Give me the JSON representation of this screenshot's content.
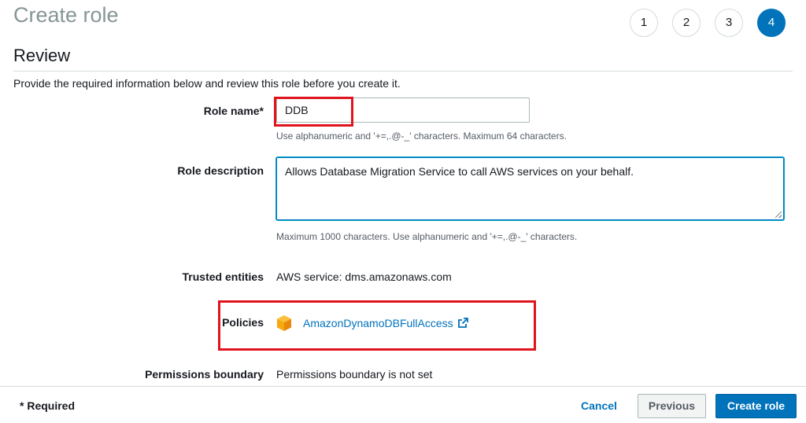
{
  "header": {
    "title": "Create role",
    "steps": [
      "1",
      "2",
      "3",
      "4"
    ],
    "active_step": "4"
  },
  "review": {
    "title": "Review",
    "intro": "Provide the required information below and review this role before you create it."
  },
  "role_name": {
    "label": "Role name*",
    "value": "DDB",
    "hint": "Use alphanumeric and '+=,.@-_' characters. Maximum 64 characters."
  },
  "role_description": {
    "label": "Role description",
    "value": "Allows Database Migration Service to call AWS services on your behalf.",
    "hint": "Maximum 1000 characters. Use alphanumeric and '+=,.@-_' characters."
  },
  "trusted_entities": {
    "label": "Trusted entities",
    "value": "AWS service: dms.amazonaws.com"
  },
  "policies": {
    "label": "Policies",
    "items": [
      {
        "name": "AmazonDynamoDBFullAccess",
        "icon": "aws-policy-cube-icon",
        "link_icon": "external-link-icon"
      }
    ]
  },
  "permissions_boundary": {
    "label": "Permissions boundary",
    "value": "Permissions boundary is not set"
  },
  "footer": {
    "required": "* Required",
    "cancel": "Cancel",
    "previous": "Previous",
    "create": "Create role"
  },
  "colors": {
    "accent": "#0073bb",
    "highlight": "#e0141e",
    "policy_icon": "#f7a80d"
  }
}
